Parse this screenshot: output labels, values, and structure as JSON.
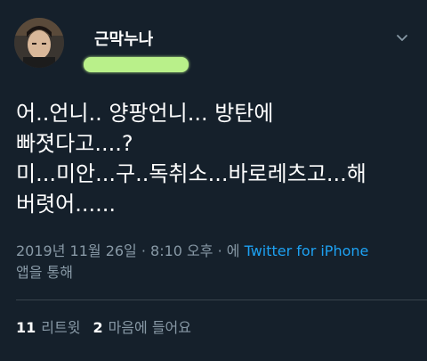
{
  "tweet": {
    "author_name": "근막누나",
    "text": "어..언니.. 양팡언니... 방탄에\n빠졋다고....?\n미...미안...구..독취소...바로레츠고...해\n버렷어......",
    "timestamp": "2019년 11월 26일 · 8:10 오후 · ",
    "via_prefix": "에 ",
    "source": "Twitter for iPhone",
    "via_suffix": "앱을 통해"
  },
  "stats": {
    "retweets_count": "11",
    "retweets_label": "리트윗",
    "likes_count": "2",
    "likes_label": "마음에 들어요"
  },
  "colors": {
    "background": "#15202b",
    "secondary_text": "#8899a6",
    "link": "#1da1f2",
    "redaction": "#b9f08a"
  },
  "icons": {
    "menu": "chevron-down-icon"
  }
}
